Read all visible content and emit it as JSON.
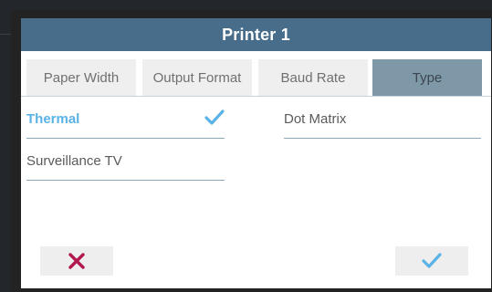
{
  "dialog": {
    "title": "Printer 1"
  },
  "tabs": [
    {
      "label": "Paper Width",
      "active": false
    },
    {
      "label": "Output Format",
      "active": false
    },
    {
      "label": "Baud Rate",
      "active": false
    },
    {
      "label": "Type",
      "active": true
    }
  ],
  "options": [
    {
      "label": "Thermal",
      "selected": true
    },
    {
      "label": "Dot Matrix",
      "selected": false
    },
    {
      "label": "Surveillance TV",
      "selected": false
    }
  ],
  "buttons": {
    "cancel_icon": "close-icon",
    "confirm_icon": "checkmark-icon"
  },
  "colors": {
    "title_bar": "#476d8b",
    "active_tab": "#7f98a8",
    "selected_text": "#5ab3e6",
    "cancel_x": "#b0184f",
    "check": "#5ab3e6"
  }
}
